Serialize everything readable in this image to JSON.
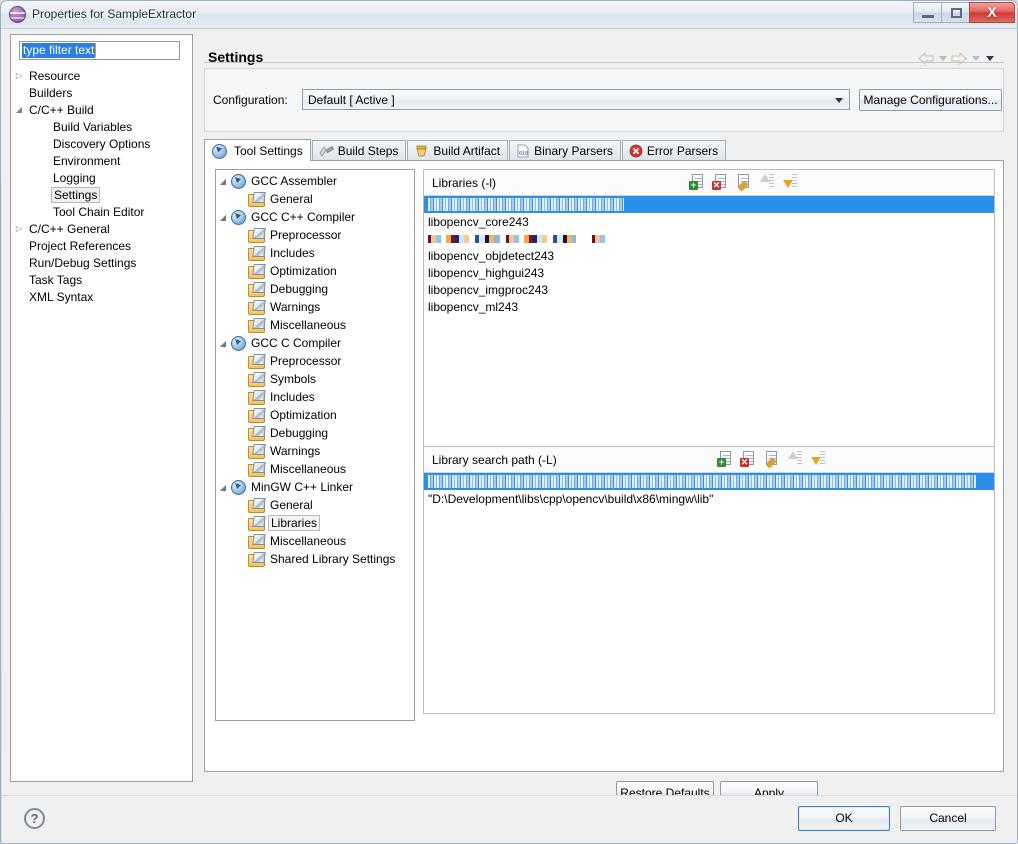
{
  "window": {
    "title": "Properties for SampleExtractor",
    "icon": "eclipse-sphere-icon",
    "controls": {
      "minimize": "minimize-icon",
      "maximize": "maximize-icon",
      "close": "X"
    }
  },
  "filter": {
    "value": "type filter text",
    "placeholder": "type filter text"
  },
  "sidebar": {
    "items": [
      {
        "label": "Resource",
        "twisty": "collapsed",
        "indent": 0,
        "selected": false
      },
      {
        "label": "Builders",
        "twisty": "none",
        "indent": 0,
        "selected": false
      },
      {
        "label": "C/C++ Build",
        "twisty": "expanded",
        "indent": 0,
        "selected": false
      },
      {
        "label": "Build Variables",
        "twisty": "none",
        "indent": 1,
        "selected": false
      },
      {
        "label": "Discovery Options",
        "twisty": "none",
        "indent": 1,
        "selected": false
      },
      {
        "label": "Environment",
        "twisty": "none",
        "indent": 1,
        "selected": false
      },
      {
        "label": "Logging",
        "twisty": "none",
        "indent": 1,
        "selected": false
      },
      {
        "label": "Settings",
        "twisty": "none",
        "indent": 1,
        "selected": true
      },
      {
        "label": "Tool Chain Editor",
        "twisty": "none",
        "indent": 1,
        "selected": false
      },
      {
        "label": "C/C++ General",
        "twisty": "collapsed",
        "indent": 0,
        "selected": false
      },
      {
        "label": "Project References",
        "twisty": "none",
        "indent": 0,
        "selected": false
      },
      {
        "label": "Run/Debug Settings",
        "twisty": "none",
        "indent": 0,
        "selected": false
      },
      {
        "label": "Task Tags",
        "twisty": "none",
        "indent": 0,
        "selected": false
      },
      {
        "label": "XML Syntax",
        "twisty": "none",
        "indent": 0,
        "selected": false
      }
    ]
  },
  "page": {
    "title": "Settings",
    "nav": {
      "back_icon": "arrow-left-icon",
      "back_menu_icon": "chevron-down-icon",
      "forward_icon": "arrow-right-icon",
      "forward_menu_icon": "chevron-down-icon",
      "view_menu_icon": "chevron-down-icon"
    }
  },
  "configuration": {
    "label": "Configuration:",
    "selected": "Default  [ Active ]",
    "options": [
      "Default  [ Active ]"
    ],
    "manage_button": "Manage Configurations...",
    "dropdown_icon": "chevron-down-icon"
  },
  "tabs": [
    {
      "label": "Tool Settings",
      "icon": "tool-settings-icon",
      "active": true
    },
    {
      "label": "Build Steps",
      "icon": "build-steps-icon",
      "active": false
    },
    {
      "label": "Build Artifact",
      "icon": "build-artifact-icon",
      "active": false
    },
    {
      "label": "Binary Parsers",
      "icon": "binary-parsers-icon",
      "active": false
    },
    {
      "label": "Error Parsers",
      "icon": "error-parsers-icon",
      "active": false
    }
  ],
  "tool_tree": [
    {
      "label": "GCC Assembler",
      "icon": "tool-icon",
      "twisty": "expanded",
      "indent": 0,
      "selected": false
    },
    {
      "label": "General",
      "icon": "folder-icon",
      "twisty": "none",
      "indent": 1,
      "selected": false
    },
    {
      "label": "GCC C++ Compiler",
      "icon": "tool-icon",
      "twisty": "expanded",
      "indent": 0,
      "selected": false
    },
    {
      "label": "Preprocessor",
      "icon": "folder-icon",
      "twisty": "none",
      "indent": 1,
      "selected": false
    },
    {
      "label": "Includes",
      "icon": "folder-icon",
      "twisty": "none",
      "indent": 1,
      "selected": false
    },
    {
      "label": "Optimization",
      "icon": "folder-icon",
      "twisty": "none",
      "indent": 1,
      "selected": false
    },
    {
      "label": "Debugging",
      "icon": "folder-icon",
      "twisty": "none",
      "indent": 1,
      "selected": false
    },
    {
      "label": "Warnings",
      "icon": "folder-icon",
      "twisty": "none",
      "indent": 1,
      "selected": false
    },
    {
      "label": "Miscellaneous",
      "icon": "folder-icon",
      "twisty": "none",
      "indent": 1,
      "selected": false
    },
    {
      "label": "GCC C Compiler",
      "icon": "tool-icon",
      "twisty": "expanded",
      "indent": 0,
      "selected": false
    },
    {
      "label": "Preprocessor",
      "icon": "folder-icon",
      "twisty": "none",
      "indent": 1,
      "selected": false
    },
    {
      "label": "Symbols",
      "icon": "folder-icon",
      "twisty": "none",
      "indent": 1,
      "selected": false
    },
    {
      "label": "Includes",
      "icon": "folder-icon",
      "twisty": "none",
      "indent": 1,
      "selected": false
    },
    {
      "label": "Optimization",
      "icon": "folder-icon",
      "twisty": "none",
      "indent": 1,
      "selected": false
    },
    {
      "label": "Debugging",
      "icon": "folder-icon",
      "twisty": "none",
      "indent": 1,
      "selected": false
    },
    {
      "label": "Warnings",
      "icon": "folder-icon",
      "twisty": "none",
      "indent": 1,
      "selected": false
    },
    {
      "label": "Miscellaneous",
      "icon": "folder-icon",
      "twisty": "none",
      "indent": 1,
      "selected": false
    },
    {
      "label": "MinGW C++ Linker",
      "icon": "tool-icon",
      "twisty": "expanded",
      "indent": 0,
      "selected": false
    },
    {
      "label": "General",
      "icon": "folder-icon",
      "twisty": "none",
      "indent": 1,
      "selected": false
    },
    {
      "label": "Libraries",
      "icon": "folder-icon",
      "twisty": "none",
      "indent": 1,
      "selected": true
    },
    {
      "label": "Miscellaneous",
      "icon": "folder-icon",
      "twisty": "none",
      "indent": 1,
      "selected": false
    },
    {
      "label": "Shared Library Settings",
      "icon": "folder-icon",
      "twisty": "none",
      "indent": 1,
      "selected": false
    }
  ],
  "libraries_group": {
    "title": "Libraries (-l)",
    "toolbar": [
      {
        "name": "add-icon",
        "enabled": true
      },
      {
        "name": "delete-icon",
        "enabled": true
      },
      {
        "name": "edit-icon",
        "enabled": true
      },
      {
        "name": "move-up-icon",
        "enabled": false
      },
      {
        "name": "move-down-icon",
        "enabled": true
      }
    ],
    "rows": [
      {
        "text": "",
        "obscured": true,
        "selected": true,
        "kind": "blurred"
      },
      {
        "text": "libopencv_core243",
        "obscured": false,
        "selected": false,
        "kind": "text"
      },
      {
        "text": "",
        "obscured": true,
        "selected": false,
        "kind": "pixelated"
      },
      {
        "text": "libopencv_objdetect243",
        "obscured": false,
        "selected": false,
        "kind": "text"
      },
      {
        "text": "libopencv_highgui243",
        "obscured": false,
        "selected": false,
        "kind": "text"
      },
      {
        "text": "libopencv_imgproc243",
        "obscured": false,
        "selected": false,
        "kind": "text"
      },
      {
        "text": "libopencv_ml243",
        "obscured": false,
        "selected": false,
        "kind": "text"
      }
    ]
  },
  "search_path_group": {
    "title": "Library search path (-L)",
    "toolbar": [
      {
        "name": "add-icon",
        "enabled": true
      },
      {
        "name": "delete-icon",
        "enabled": true
      },
      {
        "name": "edit-icon",
        "enabled": true
      },
      {
        "name": "move-up-icon",
        "enabled": false
      },
      {
        "name": "move-down-icon",
        "enabled": true
      }
    ],
    "rows": [
      {
        "text": "",
        "obscured": true,
        "selected": true,
        "kind": "blurred"
      },
      {
        "text": "\"D:\\Development\\libs\\cpp\\opencv\\build\\x86\\mingw\\lib\"",
        "obscured": false,
        "selected": false,
        "kind": "text"
      }
    ]
  },
  "page_buttons": {
    "restore_defaults": "Restore Defaults",
    "restore_defaults_mnemonic": "D",
    "apply": "Apply",
    "apply_mnemonic": "A"
  },
  "dialog_buttons": {
    "help_icon": "help-icon",
    "ok": "OK",
    "cancel": "Cancel"
  },
  "colors": {
    "selection_blue": "#2a8fe8",
    "title_text": "#1c2a38",
    "accent_ok_border": "#3c7fb1",
    "folder_icon": "#f6c45d",
    "tool_icon": "#5d91bf",
    "close_button": "#cf3b33"
  }
}
